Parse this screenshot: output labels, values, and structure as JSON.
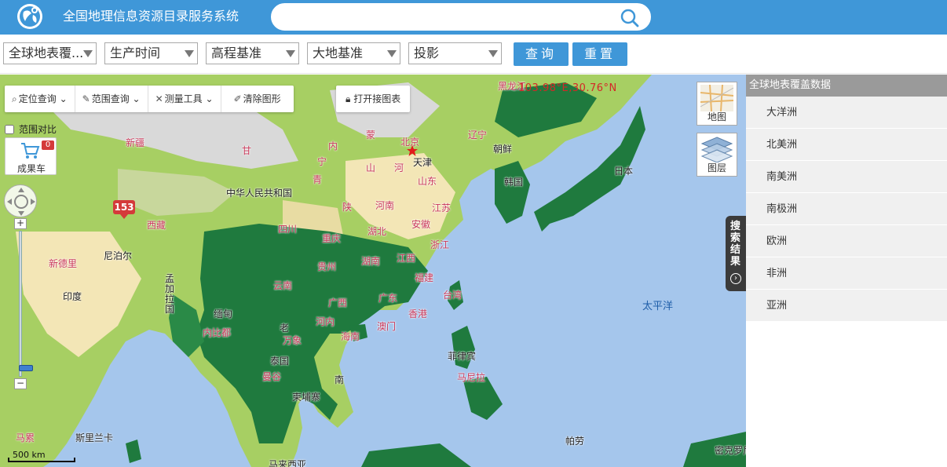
{
  "header": {
    "title": "全国地理信息资源目录服务系统",
    "search": {
      "value": "",
      "placeholder": ""
    }
  },
  "filters": {
    "selects": [
      {
        "value": "全球地表覆..."
      },
      {
        "value": "生产时间"
      },
      {
        "value": "高程基准"
      },
      {
        "value": "大地基准"
      },
      {
        "value": "投影"
      }
    ],
    "query_label": "查询",
    "reset_label": "重置"
  },
  "map": {
    "tools": [
      "定位查询",
      "范围查询",
      "测量工具",
      "清除图形"
    ],
    "open_chart_label": "打开接图表",
    "compare_label": "范围对比",
    "cart": {
      "label": "成果车",
      "count": "0"
    },
    "coordinate_readout": "103.98°E,30.76°N",
    "layer_controls": [
      "地图",
      "图层"
    ],
    "marker_count": "153",
    "scale_label": "500 km",
    "results_tab_label": "搜索结果",
    "labels": {
      "china": "中华人民共和国",
      "beijing": "北京",
      "tianjin": "天津",
      "xinjiang": "新疆",
      "tibet": "西藏",
      "gansu": "甘",
      "inner_mongolia": "内",
      "ningxia": "宁",
      "qinghai": "青",
      "sichuan": "四川",
      "yunnan": "云南",
      "guizhou": "贵州",
      "guangxi": "广西",
      "guangdong": "广东",
      "hunan": "湖南",
      "hubei": "湖北",
      "henan": "河南",
      "shandong": "山东",
      "jiangsu": "江苏",
      "zhejiang": "浙江",
      "jiangxi": "江西",
      "fujian": "福建",
      "anhui": "安徽",
      "chongqing": "重庆",
      "shaanxi": "陕",
      "shanxi": "山",
      "hebei": "河",
      "taiwan": "台湾",
      "hongkong": "香港",
      "macau": "澳门",
      "hainan": "海南",
      "mongolia": "蒙",
      "heilongjiang": "黑龙江",
      "liaoning": "辽宁",
      "korea_dprk": "朝鲜",
      "korea_rok": "韩国",
      "japan": "日本",
      "nepal": "尼泊尔",
      "india": "印度",
      "newdelhi": "新德里",
      "bangladesh": "孟加拉国",
      "myanmar": "缅甸",
      "thailand": "泰国",
      "laos": "老",
      "vientiane": "万象",
      "cambodia": "柬埔寨",
      "vietnam": "南",
      "hanoi": "河内",
      "naypyidaw": "内比都",
      "bangkok": "曼谷",
      "philippines": "菲律宾",
      "manila": "马尼拉",
      "malaysia": "马来西亚",
      "srilanka": "斯里兰卡",
      "maldives": "马累",
      "pacific": "太平洋",
      "palau": "帕劳",
      "micronesia": "密克罗尼"
    }
  },
  "panel": {
    "title": "全球地表覆盖数据",
    "items": [
      "大洋洲",
      "北美洲",
      "南美洲",
      "南极洲",
      "欧洲",
      "非洲",
      "亚洲"
    ]
  },
  "colors": {
    "header_blue": "#3f97d8",
    "ocean": "#a5c6ec",
    "forest": "#1f7a3e",
    "cropland": "#f3e6b6",
    "grassland": "#a7cf63",
    "barren": "#d9d9d9"
  }
}
